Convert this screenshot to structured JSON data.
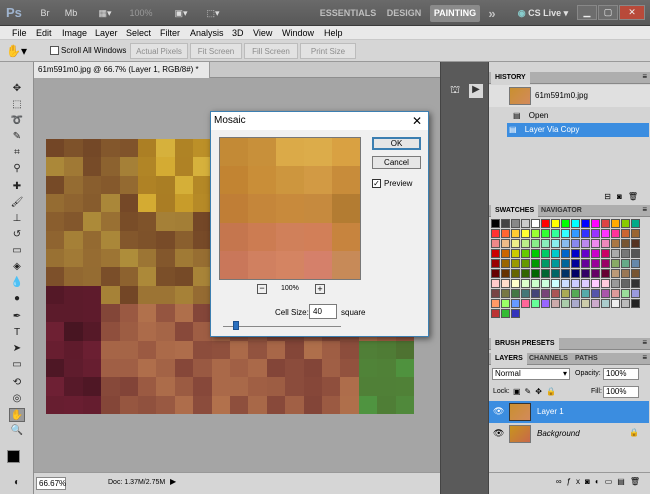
{
  "app": {
    "logo": "Ps",
    "zoom": "100%",
    "workspaces": [
      "ESSENTIALS",
      "DESIGN",
      "PAINTING"
    ],
    "more": "»",
    "cslive": "CS Live"
  },
  "menu": [
    "File",
    "Edit",
    "Image",
    "Layer",
    "Select",
    "Filter",
    "Analysis",
    "3D",
    "View",
    "Window",
    "Help"
  ],
  "options": {
    "scroll_all": "Scroll All Windows",
    "buttons": [
      "Actual Pixels",
      "Fit Screen",
      "Fill Screen",
      "Print Size"
    ]
  },
  "document": {
    "tab": "61m591m0.jpg @ 66.7% (Layer 1, RGB/8#) *",
    "close": "×",
    "zoom": "66.67%",
    "docsize": "Doc: 1.37M/2.75M"
  },
  "dialog": {
    "title": "Mosaic",
    "ok": "OK",
    "cancel": "Cancel",
    "preview": "Preview",
    "zoom": "100%",
    "minus": "−",
    "plus": "+",
    "cell_label": "Cell Size:",
    "cell_value": "40",
    "unit": "square",
    "slider_fraction": 0.07
  },
  "history": {
    "tab": "HISTORY",
    "snapshot": "61m591m0.jpg",
    "items": [
      "Open",
      "Layer Via Copy"
    ]
  },
  "swatch_tabs": [
    "SWATCHES",
    "NAVIGATOR"
  ],
  "brush_tab": "BRUSH PRESETS",
  "layer_tabs": [
    "LAYERS",
    "CHANNELS",
    "PATHS"
  ],
  "layers": {
    "blend": "Normal",
    "opacity_label": "Opacity:",
    "opacity": "100%",
    "lock_label": "Lock:",
    "fill_label": "Fill:",
    "fill": "100%",
    "items": [
      "Layer 1",
      "Background"
    ]
  },
  "colors": {
    "accent": "#3c7fb1",
    "selection": "#3b8de0"
  }
}
